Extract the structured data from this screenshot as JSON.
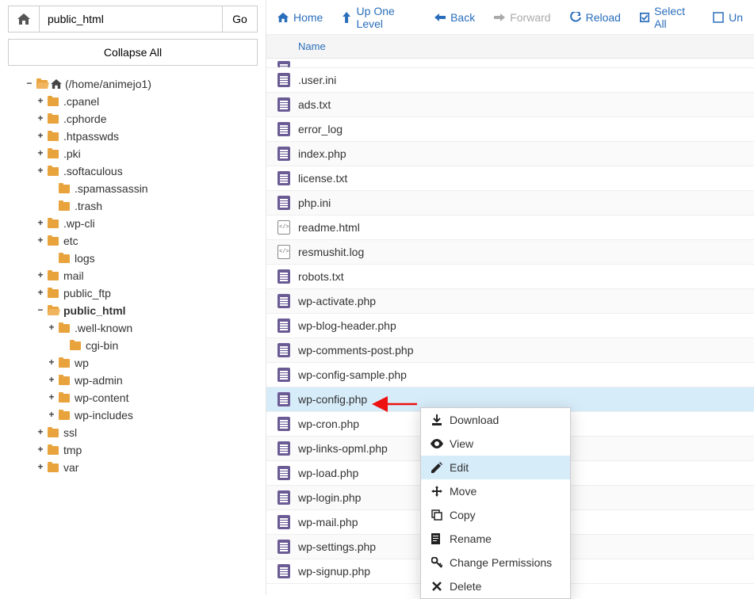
{
  "sidebar": {
    "path_input": "public_html",
    "go_label": "Go",
    "collapse_label": "Collapse All",
    "root_label": "(/home/animejo1)",
    "tree": [
      {
        "label": ".cpanel",
        "indent": 2,
        "toggle": "+"
      },
      {
        "label": ".cphorde",
        "indent": 2,
        "toggle": "+"
      },
      {
        "label": ".htpasswds",
        "indent": 2,
        "toggle": "+"
      },
      {
        "label": ".pki",
        "indent": 2,
        "toggle": "+"
      },
      {
        "label": ".softaculous",
        "indent": 2,
        "toggle": "+"
      },
      {
        "label": ".spamassassin",
        "indent": 3,
        "toggle": ""
      },
      {
        "label": ".trash",
        "indent": 3,
        "toggle": ""
      },
      {
        "label": ".wp-cli",
        "indent": 2,
        "toggle": "+"
      },
      {
        "label": "etc",
        "indent": 2,
        "toggle": "+"
      },
      {
        "label": "logs",
        "indent": 3,
        "toggle": ""
      },
      {
        "label": "mail",
        "indent": 2,
        "toggle": "+"
      },
      {
        "label": "public_ftp",
        "indent": 2,
        "toggle": "+"
      },
      {
        "label": "public_html",
        "indent": 2,
        "toggle": "−",
        "open": true,
        "bold": true
      },
      {
        "label": ".well-known",
        "indent": 3,
        "toggle": "+"
      },
      {
        "label": "cgi-bin",
        "indent": 4,
        "toggle": ""
      },
      {
        "label": "wp",
        "indent": 3,
        "toggle": "+"
      },
      {
        "label": "wp-admin",
        "indent": 3,
        "toggle": "+"
      },
      {
        "label": "wp-content",
        "indent": 3,
        "toggle": "+"
      },
      {
        "label": "wp-includes",
        "indent": 3,
        "toggle": "+"
      },
      {
        "label": "ssl",
        "indent": 2,
        "toggle": "+"
      },
      {
        "label": "tmp",
        "indent": 2,
        "toggle": "+"
      },
      {
        "label": "var",
        "indent": 2,
        "toggle": "+"
      }
    ]
  },
  "toolbar": {
    "home": "Home",
    "up": "Up One Level",
    "back": "Back",
    "forward": "Forward",
    "reload": "Reload",
    "select_all": "Select All",
    "unselect": "Un"
  },
  "table": {
    "name_header": "Name"
  },
  "files": [
    {
      "name": ".user.ini",
      "icon": "doc"
    },
    {
      "name": "ads.txt",
      "icon": "doc"
    },
    {
      "name": "error_log",
      "icon": "doc"
    },
    {
      "name": "index.php",
      "icon": "doc"
    },
    {
      "name": "license.txt",
      "icon": "doc"
    },
    {
      "name": "php.ini",
      "icon": "doc"
    },
    {
      "name": "readme.html",
      "icon": "code"
    },
    {
      "name": "resmushit.log",
      "icon": "code"
    },
    {
      "name": "robots.txt",
      "icon": "doc"
    },
    {
      "name": "wp-activate.php",
      "icon": "doc"
    },
    {
      "name": "wp-blog-header.php",
      "icon": "doc"
    },
    {
      "name": "wp-comments-post.php",
      "icon": "doc"
    },
    {
      "name": "wp-config-sample.php",
      "icon": "doc"
    },
    {
      "name": "wp-config.php",
      "icon": "doc",
      "selected": true
    },
    {
      "name": "wp-cron.php",
      "icon": "doc"
    },
    {
      "name": "wp-links-opml.php",
      "icon": "doc"
    },
    {
      "name": "wp-load.php",
      "icon": "doc"
    },
    {
      "name": "wp-login.php",
      "icon": "doc"
    },
    {
      "name": "wp-mail.php",
      "icon": "doc"
    },
    {
      "name": "wp-settings.php",
      "icon": "doc"
    },
    {
      "name": "wp-signup.php",
      "icon": "doc"
    }
  ],
  "context_menu": {
    "items": [
      {
        "label": "Download",
        "icon": "download"
      },
      {
        "label": "View",
        "icon": "eye"
      },
      {
        "label": "Edit",
        "icon": "pencil",
        "hover": true
      },
      {
        "label": "Move",
        "icon": "move"
      },
      {
        "label": "Copy",
        "icon": "copy"
      },
      {
        "label": "Rename",
        "icon": "rename"
      },
      {
        "label": "Change Permissions",
        "icon": "key"
      },
      {
        "label": "Delete",
        "icon": "delete"
      }
    ]
  }
}
